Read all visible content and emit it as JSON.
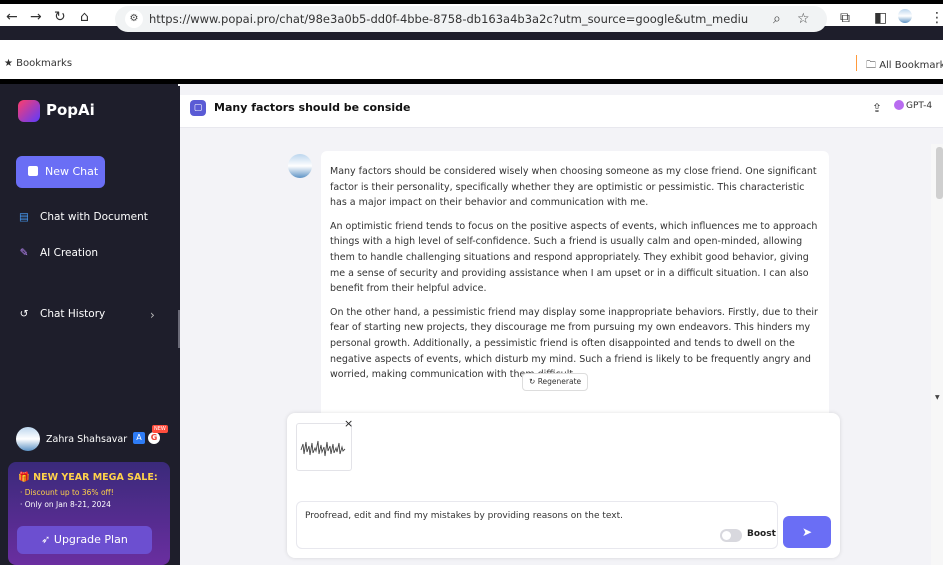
{
  "browser": {
    "url": "https://www.popai.pro/chat/98e3a0b5-dd0f-4bbe-8758-db163a4b3a2c?utm_source=google&utm_medium=YM_popai&utm_camp...",
    "bookmarks_label": "Bookmarks",
    "all_bookmarks_label": "All Bookmarks"
  },
  "sidebar": {
    "brand": "PopAi",
    "new_chat": "New Chat",
    "items": [
      {
        "label": "Chat with Document",
        "icon": "document-icon"
      },
      {
        "label": "AI Creation",
        "icon": "edit-icon"
      },
      {
        "label": "Chat History",
        "icon": "history-icon"
      }
    ],
    "user_name": "Zahra Shahsavar",
    "new_badge": "NEW",
    "promo": {
      "title": "NEW YEAR MEGA SALE:",
      "line1": "· Discount up to 36% off!",
      "line2": "· Only on Jan 8-21, 2024"
    },
    "upgrade": "Upgrade Plan"
  },
  "chat": {
    "title": "Many factors should be conside",
    "model": "GPT-4",
    "paragraphs": [
      "Many factors should be considered wisely when choosing someone as my close friend. One significant factor is their personality, specifically whether they are optimistic or pessimistic. This characteristic has a major impact on their behavior and communication with me.",
      "An optimistic friend tends to focus on the positive aspects of events, which influences me to approach things with a high level of self-confidence. Such a friend is usually calm and open-minded, allowing them to handle challenging situations and respond appropriately. They exhibit good behavior, giving me a sense of security and providing assistance when I am upset or in a difficult situation. I can also benefit from their helpful advice.",
      "On the other hand, a pessimistic friend may display some inappropriate behaviors. Firstly, due to their fear of starting new projects, they discourage me from pursuing my own endeavors. This hinders my personal growth. Additionally, a pessimistic friend is often disappointed and tends to dwell on the negative aspects of events, which disturb my mind. Such a friend is likely to be frequently angry and worried, making communication with them difficult."
    ],
    "regenerate": "Regenerate"
  },
  "composer": {
    "input_value": "Proofread, edit and find my mistakes by providing reasons on the text.",
    "boost_label": "Boost",
    "attachment_close": "×"
  },
  "colors": {
    "accent": "#6a6ef5",
    "sidebar_bg": "#1e1e2b",
    "promo_highlight": "#ffd24a"
  }
}
